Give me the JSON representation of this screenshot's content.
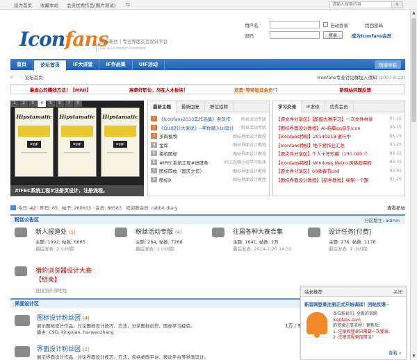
{
  "topbar": {
    "links": [
      "设为首页",
      "收藏本站",
      "会员优秀作品(图片测试)"
    ],
    "search_placeholder": "请输入搜索内容"
  },
  "header": {
    "logo_main": "Icon",
    "logo_accent": "fans",
    "tagline": "图标粉丝 | 专业界面交互设计平台",
    "tagline_sub": "GUI & UI design showcase"
  },
  "login": {
    "username_label": "用户名",
    "password_label": "密码",
    "auto_login": "自动登录",
    "find_password": "找回密码",
    "login_button": "登录",
    "become_member": "成为Iconfans会员"
  },
  "nav": {
    "items": [
      "首页",
      "论坛首页",
      "IF大讲堂",
      "IF作品集",
      "UIF活动"
    ],
    "quick": "快捷导航"
  },
  "breadcrumb": {
    "root": "论坛首页",
    "notice": "Iconfans专业讨论群加入须知",
    "date": "(2007-8-22)"
  },
  "announce": [
    "最省心的赚钱方法！【MIUI】",
    "高薪好职位，尽在人才板块！",
    "还是\"等待验证会员\"？",
    "新网站问题反馈"
  ],
  "slide": {
    "thumbs": [
      "1",
      "2",
      "3",
      "4",
      "5",
      "6",
      "7",
      "8"
    ],
    "brand": "Hipstamatic",
    "badge": "oggl",
    "caption": "#IFEC系统工程#注册页设计，注册流程。"
  },
  "panel1": {
    "tabs": [
      "最新主题",
      "最新回复",
      "职位招聘"
    ],
    "items": [
      {
        "n": "1",
        "t": "《Iconfans2013年作品集》会员作",
        "meta": "粉丝活动专版"
      },
      {
        "n": "2",
        "t": "《GUI设计大家说》--帮你踏入UI设计",
        "meta": "粉丝活动专版"
      },
      {
        "n": "3",
        "t": "多肉植物",
        "meta": "图标界面设计教程"
      },
      {
        "n": "4",
        "t": "金库",
        "meta": "图标界面设计教程"
      },
      {
        "n": "5",
        "t": "相机图标",
        "meta": "图标界面设计教程"
      },
      {
        "n": "6",
        "t": "#IFEC系统工程#进度条",
        "meta": "IFEC超萌小组学习板块"
      },
      {
        "n": "7",
        "t": "图标四枚（国庆之作）",
        "meta": "图标界面设计教程"
      },
      {
        "n": "8",
        "t": "图标9",
        "meta": "图标界面设计教程"
      }
    ]
  },
  "panel2": {
    "tabs": [
      "学习交流",
      "IF发现",
      "优秀会员"
    ],
    "items": [
      {
        "t": "【源文件分享区】【酷酷大赛学习】一次文件共享",
        "d": "07-16"
      },
      {
        "t": "【图标界面设计教程】AI-临摹qq音乐icon",
        "d": "06-15"
      },
      {
        "t": "【Iconfans特权】20140219 进行中",
        "d": "05-29"
      },
      {
        "t": "【Iconfans特权】地下党作业汇总",
        "d": "05-26"
      },
      {
        "t": "【源文件分享区】个人十年珍藏（130.000 个",
        "d": "04-22"
      },
      {
        "t": "【Iconfans特权】Windows Metro 风格应用的",
        "d": "03-31"
      },
      {
        "t": "【源文件分享区】60款春节psd",
        "d": "03-01"
      },
      {
        "t": "【图标界面设计教程】【新手教程】绘制一个飘",
        "d": "01-26"
      }
    ]
  },
  "stats": {
    "today_label": "今日",
    "today": "42",
    "yesterday_label": "昨日",
    "yesterday": "65",
    "posts_label": "帖子",
    "posts": "260653",
    "members_label": "会员",
    "members": "88583",
    "welcome_label": "欢迎新会员",
    "welcome": "rabbit.diary",
    "latest": "查看新帖"
  },
  "section1": {
    "title": "粉丝公告区",
    "mod_label": "分区版主",
    "mod": "admin"
  },
  "forums": [
    {
      "name": "新人报道处",
      "count": "(1)",
      "stat": "主题: 1992, 帖数: 6665",
      "last": "最后发表: 2 小时前"
    },
    {
      "name": "粉丝活动专版",
      "count": "(4)",
      "stat": "主题: 284, 帖数: 7268",
      "last": "最后发表: 1 小时前"
    },
    {
      "name": "往届各种大赛合集",
      "count": "",
      "stat": "主题: 1641, 帖数: 1万",
      "last": "最后发表: 2014-2-20 14:33"
    },
    {
      "name": "设计任务[付费]",
      "count": "",
      "stat": "主题: 276, 帖数: 1176",
      "last": "最后发表: 2 小时前"
    }
  ],
  "contest": {
    "name": "猎豹浏览器设计大赛",
    "status": "【结束】",
    "link": "链接到外部地址"
  },
  "section2": {
    "title": "界面设计区"
  },
  "iforums": [
    {
      "name": "图标设计粉丝团",
      "count": "(4)",
      "desc": "展示图标设计作品，讨论图标设计技巧、方法，分享图标创作、图标学习经验。",
      "mods": "版主: C9D, kingxjan, harwenzhang"
    },
    {
      "name": "界面设计粉丝团",
      "count": "(1)",
      "desc": "展示界面设计作品，讨论界面设计技巧、方法，包括桌面平台、移动平台等界面设计。",
      "mods": ""
    }
  ],
  "side_count": "1万 / 9",
  "popup": {
    "title": "站长推荐",
    "close": "关闭",
    "headline": "新官网登录注册正式开始调试！回帖反馈~",
    "line1": "各位粉丝们, 全新的官网",
    "line2": "iconfans.com",
    "line3": "的登录注册流程！更新后：",
    "line4": "1. 注册和登录只需要一次登录。",
    "line5": "2. 注册流程更加简洁！",
    "more": "查看 »"
  }
}
